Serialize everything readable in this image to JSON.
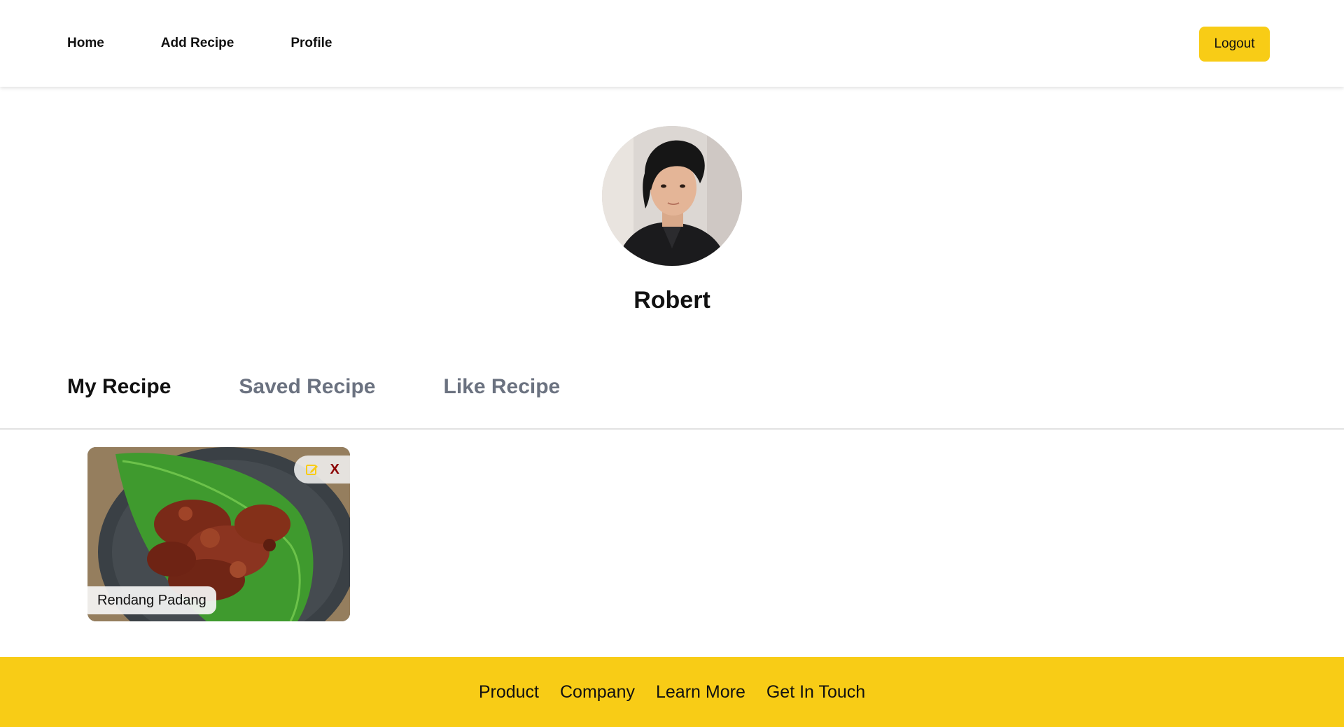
{
  "nav": {
    "items": [
      {
        "label": "Home"
      },
      {
        "label": "Add Recipe"
      },
      {
        "label": "Profile"
      }
    ],
    "logout_label": "Logout"
  },
  "profile": {
    "name": "Robert"
  },
  "tabs": [
    {
      "label": "My Recipe",
      "active": true
    },
    {
      "label": "Saved Recipe",
      "active": false
    },
    {
      "label": "Like Recipe",
      "active": false
    }
  ],
  "recipes": [
    {
      "title": "Rendang Padang",
      "delete_label": "X",
      "edit_icon": "edit-icon"
    }
  ],
  "footer": {
    "links": [
      {
        "label": "Product"
      },
      {
        "label": "Company"
      },
      {
        "label": "Learn More"
      },
      {
        "label": "Get In Touch"
      }
    ]
  },
  "colors": {
    "accent": "#f8cc16",
    "delete": "#8b0000",
    "tab_inactive": "#6b7280"
  }
}
